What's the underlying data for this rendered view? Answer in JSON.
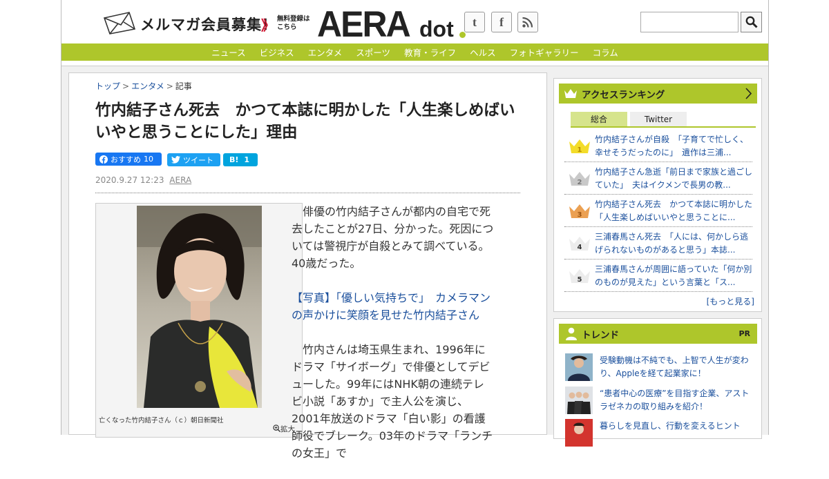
{
  "header": {
    "mail_text": "メルマガ会員募集！",
    "mail_arrow": "》",
    "mail_sub_1": "無料登録は",
    "mail_sub_2": "こちら",
    "logo_aera": "AERA",
    "logo_dot": "dot",
    "social": [
      {
        "icon": "twitter-icon",
        "glyph": "t"
      },
      {
        "icon": "facebook-icon",
        "glyph": "f"
      },
      {
        "icon": "rss-icon",
        "glyph": ""
      }
    ],
    "search_placeholder": ""
  },
  "nav": [
    "ニュース",
    "ビジネス",
    "エンタメ",
    "スポーツ",
    "教育・ライフ",
    "ヘルス",
    "フォトギャラリー",
    "コラム"
  ],
  "breadcrumb": {
    "home": "トップ",
    "category": "エンタメ",
    "current": "記事"
  },
  "article": {
    "title": "竹内結子さん死去　かつて本誌に明かした「人生楽しめばいいやと思うことにした」理由",
    "fb_label": "おすすめ",
    "fb_count": "10",
    "tw_label": "ツイート",
    "hb_label": "B!",
    "hb_count": "1",
    "date": "2020.9.27 12:23",
    "source": "AERA",
    "caption": "亡くなった竹内結子さん（ｃ）朝日新聞社",
    "zoom": "拡大",
    "p1": "俳優の竹内結子さんが都内の自宅で死去したことが27日、分かった。死因については警視庁が自殺とみて調べている。40歳だった。",
    "p2": "【写真】「優しい気持ちで」　カメラマンの声かけに笑顔を見せた竹内結子さん",
    "p3": "竹内さんは埼玉県生まれ、1996年にドラマ「サイボーグ」で俳優としてデビューした。99年にはNHK朝の連続テレビ小説「あすか」で主人公を演じ、2001年放送のドラマ「白い影」の看護師役でブレーク。03年のドラマ「ランチの女王」で"
  },
  "ranking": {
    "title": "アクセスランキング",
    "tab_all": "総合",
    "tab_twitter": "Twitter",
    "items": [
      {
        "rank": "1",
        "text": "竹内結子さんが自殺　「子育てで忙しく、幸せそうだったのに」　遺作は三浦..."
      },
      {
        "rank": "2",
        "text": "竹内結子さん急逝「前日まで家族と過ごしていた」　夫はイクメンで長男の教..."
      },
      {
        "rank": "3",
        "text": "竹内結子さん死去　かつて本誌に明かした「人生楽しめばいいやと思うことに..."
      },
      {
        "rank": "4",
        "text": "三浦春馬さん死去　「人には、何かしら逃げられないものがあると思う」本誌..."
      },
      {
        "rank": "5",
        "text": "三浦春馬さんが周囲に語っていた「何か別のものが見えた」という言葉と「ス..."
      }
    ],
    "more": "[もっと見る]"
  },
  "trend": {
    "title": "トレンド",
    "pr": "PR",
    "items": [
      {
        "text": "受験動機は不純でも、上智で人生が変わり、Appleを経て起業家に！"
      },
      {
        "text": "“患者中心の医療”を目指す企業、アストラゼネカの取り組みを紹介！"
      },
      {
        "text": "暮らしを見直し、行動を変えるヒント"
      }
    ]
  },
  "colors": {
    "accent": "#aec62b",
    "link": "#1a4f9c",
    "facebook": "#1877f2",
    "twitter": "#1da1f2",
    "hatena": "#00a4de"
  }
}
